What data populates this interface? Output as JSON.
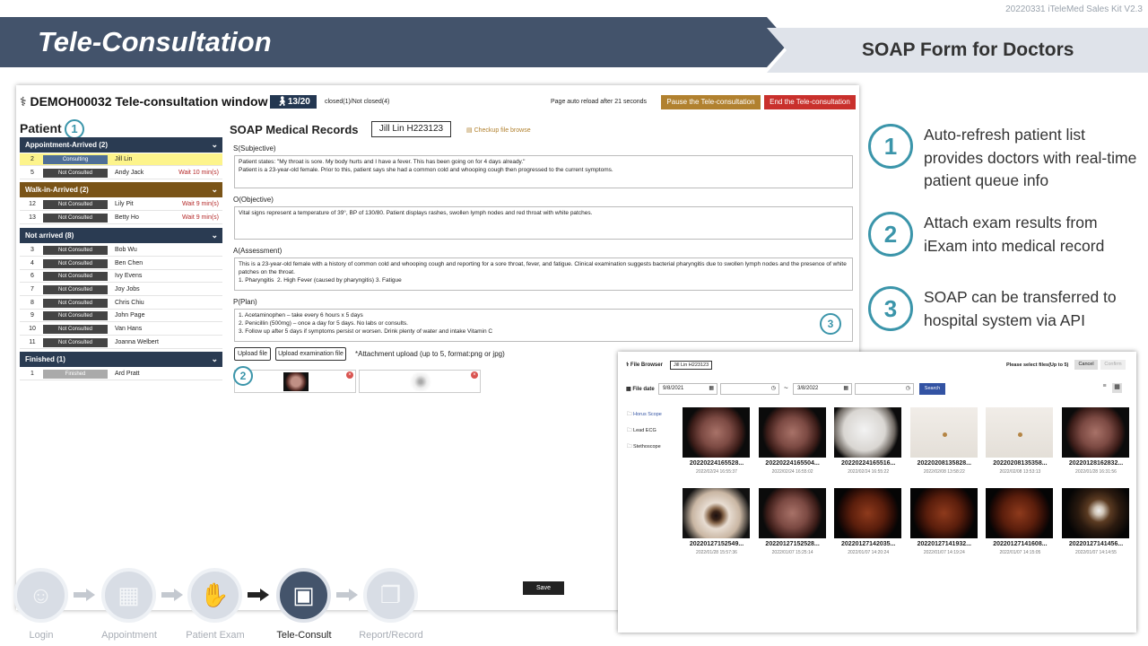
{
  "header": {
    "kit_label": "20220331 iTeleMed Sales Kit V2.3",
    "title": "Tele-Consultation",
    "subtitle": "SOAP Form for Doctors"
  },
  "app": {
    "window_title": "DEMOH00032 Tele-consultation window",
    "pager": "13/20",
    "closed_status": "closed(1)/Not closed(4)",
    "reload_note": "Page auto reload after 21 seconds",
    "pause_label": "Pause the Tele-consultation",
    "end_label": "End the Tele-consultation",
    "patient_heading": "Patient",
    "patient_badge": "1",
    "groups": [
      {
        "label": "Appointment-Arrived (2)",
        "color": "#2a3b52",
        "rows": [
          {
            "n": "2",
            "status": "Consulting",
            "name": "Jill Lin",
            "wait": "",
            "highlight": true
          },
          {
            "n": "5",
            "status": "Not Consulted",
            "name": "Andy Jack",
            "wait": "Wait 10 min(s)"
          }
        ]
      },
      {
        "label": "Walk-in-Arrived (2)",
        "color": "#7a5418",
        "rows": [
          {
            "n": "12",
            "status": "Not Consulted",
            "name": "Lily Pit",
            "wait": "Wait 9 min(s)"
          },
          {
            "n": "13",
            "status": "Not Consulted",
            "name": "Betty Ho",
            "wait": "Wait 9 min(s)"
          }
        ]
      },
      {
        "label": "Not arrived (8)",
        "color": "#2a3b52",
        "rows": [
          {
            "n": "3",
            "status": "Not Consulted",
            "name": "Bob Wu",
            "wait": ""
          },
          {
            "n": "4",
            "status": "Not Consulted",
            "name": "Ben Chen",
            "wait": ""
          },
          {
            "n": "6",
            "status": "Not Consulted",
            "name": "Ivy Evens",
            "wait": ""
          },
          {
            "n": "7",
            "status": "Not Consulted",
            "name": "Joy Jobs",
            "wait": ""
          },
          {
            "n": "8",
            "status": "Not Consulted",
            "name": "Chris Chiu",
            "wait": ""
          },
          {
            "n": "9",
            "status": "Not Consulted",
            "name": "John Page",
            "wait": ""
          },
          {
            "n": "10",
            "status": "Not Consulted",
            "name": "Van Hans",
            "wait": ""
          },
          {
            "n": "11",
            "status": "Not Consulted",
            "name": "Joanna Welbert",
            "wait": ""
          }
        ]
      },
      {
        "label": "Finished (1)",
        "color": "#2a3b52",
        "rows": [
          {
            "n": "1",
            "status": "Finished",
            "name": "Ard Pratt",
            "wait": "",
            "finished": true
          }
        ]
      }
    ],
    "soap": {
      "title": "SOAP Medical Records",
      "patient_tag": "Jill Lin    H223123",
      "checkup_link": "Checkup file browse",
      "s_label": "S(Subjective)",
      "s_text": "Patient states: \"My throat is sore. My body hurts and I have a fever. This has been going on for 4 days already.\"\nPatient is a 23-year-old female. Prior to this, patient says she had a common cold and whooping cough then progressed to the current symptoms.",
      "o_label": "O(Objective)",
      "o_text": "Vital signs represent a temperature of 39°, BP of 130/80. Patient displays rashes, swollen lymph nodes and red throat with white patches.",
      "a_label": "A(Assessment)",
      "a_text": "This is a 23-year-old female with a history of common cold and whooping cough and reporting for a sore throat, fever, and fatigue. Clinical examination suggests bacterial pharyngitis due to swollen lymph nodes and the presence of white patches on the throat.\n1. Pharyngitis  2. High Fever (caused by pharyngitis) 3. Fatigue",
      "p_label": "P(Plan)",
      "p_text": "1. Acetaminophen – take every 6 hours x 5 days\n2. Penicillin (500mg) – once a day for 5 days. No labs or consults.\n3. Follow up after 5 days if symptoms persist or worsen. Drink plenty of water and intake Vitamin C",
      "plan_badge": "3",
      "upload_file": "Upload file",
      "upload_exam": "Upload examination file",
      "attach_note": "*Attachment upload (up to 5, format:png or jpg)",
      "attach_badge": "2",
      "save": "Save"
    }
  },
  "features": [
    {
      "num": "1",
      "text": "Auto-refresh  patient list provides doctors with real-time patient queue info"
    },
    {
      "num": "2",
      "text": "Attach exam results from iExam into medical record"
    },
    {
      "num": "3",
      "text": "SOAP can be transferred to hospital system via API"
    }
  ],
  "file_browser": {
    "title": "File Browser",
    "patient": "Jill Lin H223123",
    "select_note": "Please select files(Up to 5)",
    "cancel": "Cancel",
    "confirm": "Confirm",
    "file_date": "File date",
    "date_from": "9/8/2021",
    "date_to": "3/8/2022",
    "tilde": "~",
    "search": "Search",
    "folders": [
      "Horus Scope",
      "Lead ECG",
      "Stethoscope"
    ],
    "files": [
      {
        "name": "20220224165528...",
        "date": "2022/02/24 16:55:37",
        "kind": "ear"
      },
      {
        "name": "20220224165504...",
        "date": "2022/02/24 16:55:02",
        "kind": "ear"
      },
      {
        "name": "20220224165516...",
        "date": "2022/02/24 16:55:22",
        "kind": "white"
      },
      {
        "name": "20220208135828...",
        "date": "2022/02/08 13:58:22",
        "kind": "skin"
      },
      {
        "name": "20220208135358...",
        "date": "2022/02/08 13:53:13",
        "kind": "skin"
      },
      {
        "name": "20220128162832...",
        "date": "2022/01/28 16:31:56",
        "kind": "ear"
      },
      {
        "name": "20220127152549...",
        "date": "2022/01/28 15:57:36",
        "kind": "eye"
      },
      {
        "name": "20220127152528...",
        "date": "2022/01/07 15:25:14",
        "kind": "ear"
      },
      {
        "name": "20220127142035...",
        "date": "2022/01/07 14:20:24",
        "kind": "retina"
      },
      {
        "name": "20220127141932...",
        "date": "2022/01/07 14:19:24",
        "kind": "retina"
      },
      {
        "name": "20220127141608...",
        "date": "2022/01/07 14:15:05",
        "kind": "retina"
      },
      {
        "name": "20220127141456...",
        "date": "2022/01/07 14:14:55",
        "kind": "eye2"
      }
    ]
  },
  "steps": [
    {
      "label": "Login",
      "icon": "login-icon"
    },
    {
      "label": "Appointment",
      "icon": "calendar-icon"
    },
    {
      "label": "Patient Exam",
      "icon": "exam-icon"
    },
    {
      "label": "Tele-Consult",
      "icon": "tele-consult-icon",
      "active": true
    },
    {
      "label": "Report/Record",
      "icon": "report-icon"
    }
  ]
}
